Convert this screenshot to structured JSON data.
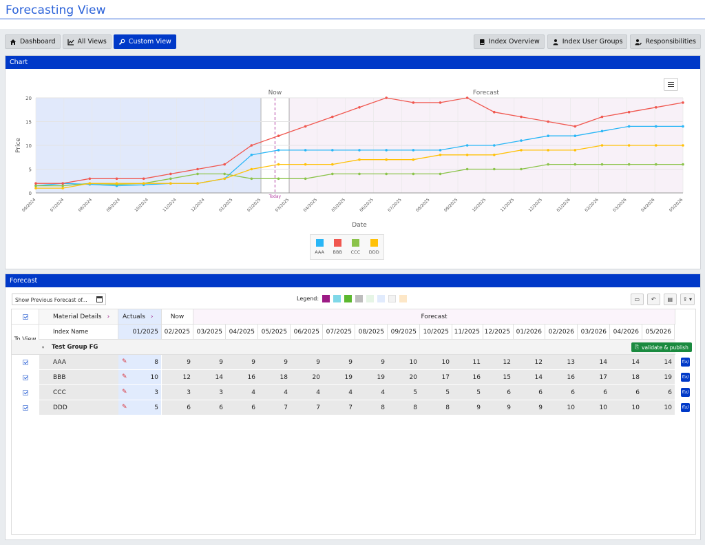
{
  "page": {
    "title": "Forecasting View"
  },
  "toolbar_left": [
    {
      "label": "Dashboard",
      "icon": "home-icon",
      "active": false
    },
    {
      "label": "All Views",
      "icon": "line-chart-icon",
      "active": false
    },
    {
      "label": "Custom View",
      "icon": "wrench-icon",
      "active": true
    }
  ],
  "toolbar_right": [
    {
      "label": "Index Overview",
      "icon": "book-icon"
    },
    {
      "label": "Index User Groups",
      "icon": "user-icon"
    },
    {
      "label": "Responsibilities",
      "icon": "user-edit-icon"
    }
  ],
  "chart_panel": {
    "title": "Chart"
  },
  "chart_data": {
    "type": "line",
    "xlabel": "Date",
    "ylabel": "Price",
    "ylim": [
      0,
      20
    ],
    "yticks": [
      0,
      5,
      10,
      15,
      20
    ],
    "categories": [
      "06/2024",
      "07/2024",
      "08/2024",
      "09/2024",
      "10/2024",
      "11/2024",
      "12/2024",
      "01/2025",
      "02/2025",
      "03/2025",
      "04/2025",
      "05/2025",
      "06/2025",
      "07/2025",
      "08/2025",
      "09/2025",
      "10/2025",
      "11/2025",
      "12/2025",
      "01/2026",
      "02/2026",
      "03/2026",
      "04/2026",
      "05/2026"
    ],
    "x": [
      "06/2024",
      "07/2024",
      "08/2024",
      "09/2024",
      "10/2024",
      "11/2024",
      "12/2024",
      "01/2025",
      "02/2025",
      "03/2025",
      "04/2025",
      "05/2025",
      "06/2025",
      "07/2025",
      "08/2025",
      "09/2025",
      "10/2025",
      "11/2025",
      "12/2025",
      "01/2026",
      "02/2026",
      "03/2026",
      "04/2026",
      "05/2026"
    ],
    "regions": [
      {
        "label": "",
        "from": "06/2024",
        "to": "02/2025"
      },
      {
        "label": "Now",
        "from": "02/2025",
        "to": "03/2025"
      },
      {
        "label": "Forecast",
        "from": "03/2025",
        "to": "05/2026"
      }
    ],
    "marker_label": "Today",
    "grid": true,
    "legend_position": "bottom",
    "series": [
      {
        "name": "AAA",
        "color": "#29b6f6",
        "values": [
          1.5,
          2,
          1.8,
          1.5,
          1.7,
          2,
          2,
          3,
          8,
          9,
          9,
          9,
          9,
          9,
          9,
          9,
          10,
          10,
          11,
          12,
          12,
          13,
          14,
          14,
          14
        ]
      },
      {
        "name": "BBB",
        "color": "#f0574f",
        "values": [
          2,
          2,
          3,
          3,
          3,
          4,
          5,
          6,
          10,
          12,
          14,
          16,
          18,
          20,
          19,
          19,
          20,
          17,
          16,
          15,
          14,
          16,
          17,
          18,
          19
        ]
      },
      {
        "name": "CCC",
        "color": "#8bc34a",
        "values": [
          1.5,
          1.5,
          2,
          1.8,
          2,
          3,
          4,
          4,
          3,
          3,
          3,
          4,
          4,
          4,
          4,
          4,
          5,
          5,
          5,
          6,
          6,
          6,
          6,
          6,
          6
        ]
      },
      {
        "name": "DDD",
        "color": "#ffc107",
        "values": [
          1,
          1,
          2,
          2,
          2,
          2,
          2,
          3,
          5,
          6,
          6,
          6,
          7,
          7,
          7,
          8,
          8,
          8,
          9,
          9,
          9,
          10,
          10,
          10,
          10
        ]
      }
    ]
  },
  "forecast_panel": {
    "title": "Forecast",
    "prev_forecast_placeholder": "Show Previous Forecast of...",
    "legend_label": "Legend:",
    "legend_colors": [
      "#9c1b85",
      "#7fd8e8",
      "#5cb82f",
      "#bdbdbd",
      "#e6f5e6",
      "#e1ebfd",
      "#f3f3f3",
      "#fde7c7"
    ],
    "headers": {
      "to_view": "To View",
      "material_details": "Material Details",
      "actuals": "Actuals",
      "now": "Now",
      "forecast": "Forecast",
      "index_name": "Index Name"
    },
    "months": [
      "01/2025",
      "02/2025",
      "03/2025",
      "04/2025",
      "05/2025",
      "06/2025",
      "07/2025",
      "08/2025",
      "09/2025",
      "10/2025",
      "11/2025",
      "12/2025",
      "01/2026",
      "02/2026",
      "03/2026",
      "04/2026",
      "05/2026"
    ],
    "group": {
      "name": "Test Group FG",
      "action_label": "validate & publish"
    },
    "rows": [
      {
        "name": "AAA",
        "values": [
          8,
          9,
          9,
          9,
          9,
          9,
          9,
          9,
          10,
          10,
          11,
          12,
          12,
          13,
          14,
          14,
          14
        ]
      },
      {
        "name": "BBB",
        "values": [
          10,
          12,
          14,
          16,
          18,
          20,
          19,
          19,
          20,
          17,
          16,
          15,
          14,
          16,
          17,
          18,
          19
        ]
      },
      {
        "name": "CCC",
        "values": [
          3,
          3,
          3,
          4,
          4,
          4,
          4,
          4,
          5,
          5,
          5,
          6,
          6,
          6,
          6,
          6,
          6
        ]
      },
      {
        "name": "DDD",
        "values": [
          5,
          6,
          6,
          6,
          7,
          7,
          7,
          8,
          8,
          8,
          9,
          9,
          9,
          10,
          10,
          10,
          10
        ]
      }
    ],
    "fx_label": "f(x)"
  }
}
